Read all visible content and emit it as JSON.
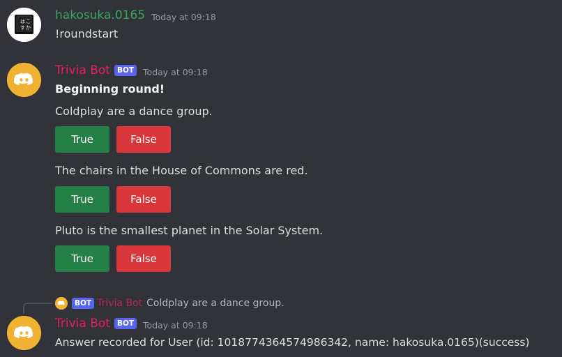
{
  "messages": [
    {
      "author": "hakosuka.0165",
      "author_color": "#3ba55d",
      "timestamp": "Today at 09:18",
      "avatar_icon": "kanji-keycap-avatar",
      "avatar_text": "はこすか",
      "content": "!roundstart"
    },
    {
      "author": "Trivia Bot",
      "author_color": "#e91e63",
      "badge": "BOT",
      "timestamp": "Today at 09:18",
      "avatar_icon": "discord-logo-avatar",
      "heading": "Beginning round!",
      "questions": [
        {
          "text": "Coldplay are a dance group.",
          "true_label": "True",
          "false_label": "False"
        },
        {
          "text": "The chairs in the House of Commons are red.",
          "true_label": "True",
          "false_label": "False"
        },
        {
          "text": "Pluto is the smallest planet in the Solar System.",
          "true_label": "True",
          "false_label": "False"
        }
      ]
    },
    {
      "reply": {
        "badge": "BOT",
        "author": "Trivia Bot",
        "text": "Coldplay are a dance group."
      },
      "author": "Trivia Bot",
      "author_color": "#e91e63",
      "badge": "BOT",
      "timestamp": "Today at 09:18",
      "avatar_icon": "discord-logo-avatar",
      "content": "Answer recorded for User (id: 1018774364574986342, name: hakosuka.0165)(success)"
    }
  ],
  "colors": {
    "background": "#313338",
    "button_true": "#248046",
    "button_false": "#da373c",
    "badge": "#5865f2",
    "discord_avatar": "#f0b232"
  }
}
